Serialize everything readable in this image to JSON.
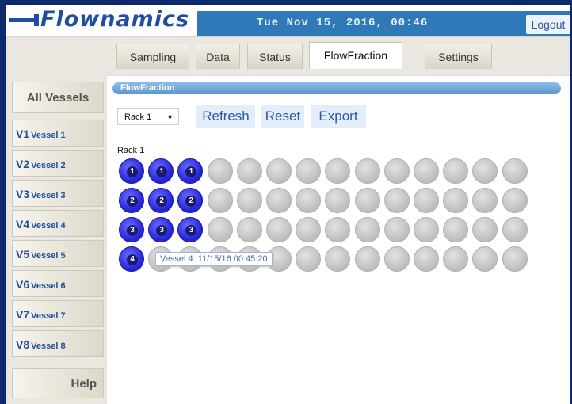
{
  "header": {
    "logo": "Flownamics",
    "datetime": "Tue Nov 15, 2016, 00:46",
    "logout_label": "Logout"
  },
  "tabs": [
    {
      "label": "Sampling"
    },
    {
      "label": "Data"
    },
    {
      "label": "Status"
    },
    {
      "label": "FlowFraction",
      "active": true
    },
    {
      "label": "Settings"
    }
  ],
  "sidebar": {
    "all_vessels": "All Vessels",
    "vessels": [
      {
        "code": "V1",
        "name": "Vessel 1"
      },
      {
        "code": "V2",
        "name": "Vessel 2"
      },
      {
        "code": "V3",
        "name": "Vessel 3"
      },
      {
        "code": "V4",
        "name": "Vessel 4"
      },
      {
        "code": "V5",
        "name": "Vessel 5"
      },
      {
        "code": "V6",
        "name": "Vessel 6"
      },
      {
        "code": "V7",
        "name": "Vessel 7"
      },
      {
        "code": "V8",
        "name": "Vessel 8"
      }
    ],
    "help": "Help"
  },
  "main": {
    "section_title": "FlowFraction",
    "rack_select": "Rack 1",
    "buttons": {
      "refresh": "Refresh",
      "reset": "Reset",
      "export": "Export"
    },
    "rack_label": "Rack 1",
    "tooltip": "Vessel 4: 11/15/16 00:45:20",
    "rows": [
      [
        "1",
        "1",
        "1",
        "",
        "",
        "",
        "",
        "",
        "",
        "",
        "",
        "",
        "",
        ""
      ],
      [
        "2",
        "2",
        "2",
        "",
        "",
        "",
        "",
        "",
        "",
        "",
        "",
        "",
        "",
        ""
      ],
      [
        "3",
        "3",
        "3",
        "",
        "",
        "",
        "",
        "",
        "",
        "",
        "",
        "",
        "",
        ""
      ],
      [
        "4",
        "",
        "",
        "",
        "",
        "",
        "",
        "",
        "",
        "",
        "",
        "",
        "",
        ""
      ]
    ]
  },
  "colors": {
    "header_blue": "#3079b9",
    "filled_well": "#2424d8",
    "empty_well": "#c4c4c4"
  }
}
